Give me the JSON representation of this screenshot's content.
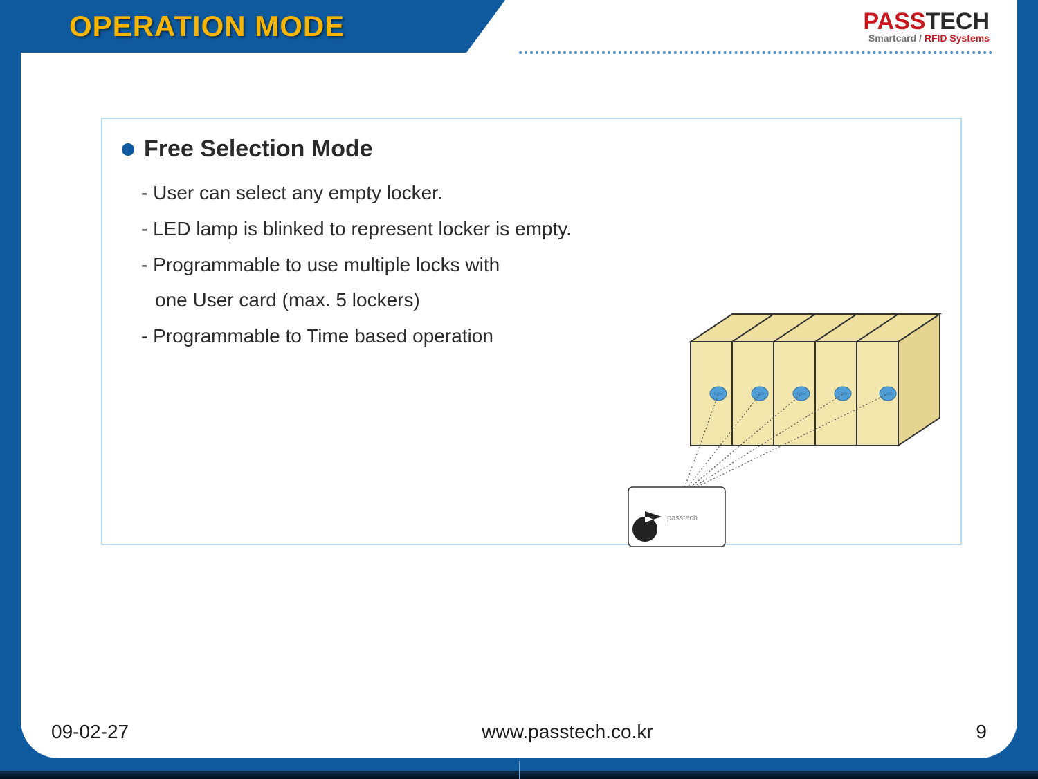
{
  "header": {
    "title": "OPERATION MODE"
  },
  "logo": {
    "brand_prefix": "PASS",
    "brand_suffix": "TECH",
    "tagline_pre": "Smartcard / ",
    "tagline_highlight": "RFID Systems"
  },
  "panel": {
    "heading": "Free Selection Mode",
    "bullets": [
      "- User can select any empty locker.",
      "- LED lamp is blinked to represent locker is empty.",
      "- Programmable to use multiple locks with",
      "one User card (max. 5 lockers)",
      "- Programmable to Time based operation"
    ]
  },
  "illustration": {
    "card_label": "passtech",
    "lock_label": "Lock"
  },
  "footer": {
    "date": "09-02-27",
    "url": "www.passtech.co.kr",
    "page": "9"
  }
}
